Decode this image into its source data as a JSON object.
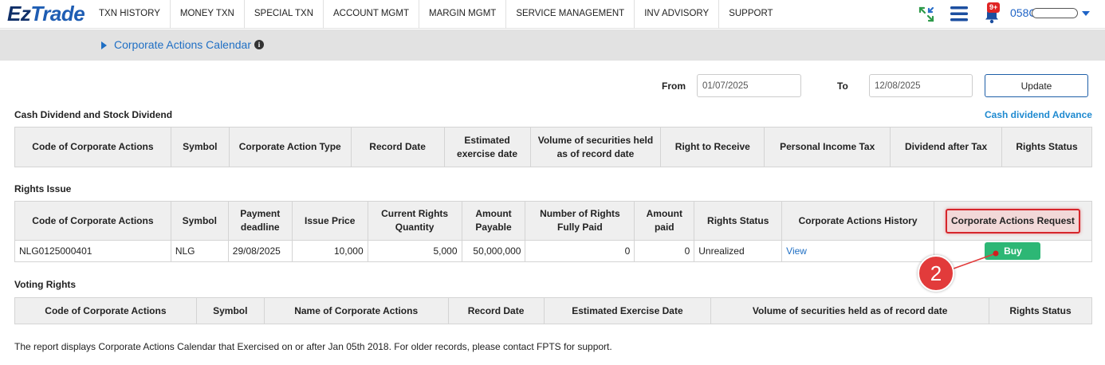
{
  "logo": {
    "part1": "Ez",
    "part2": "Trade"
  },
  "nav": [
    {
      "label": "TXN HISTORY"
    },
    {
      "label": "MONEY TXN"
    },
    {
      "label": "SPECIAL TXN"
    },
    {
      "label": "ACCOUNT MGMT"
    },
    {
      "label": "MARGIN MGMT"
    },
    {
      "label": "SERVICE MANAGEMENT"
    },
    {
      "label": "INV ADVISORY"
    },
    {
      "label": "SUPPORT"
    }
  ],
  "header_icons": {
    "expand": "expand-arrows-icon",
    "menu": "hamburger-menu-icon",
    "bell": "bell-icon",
    "badge": "9+"
  },
  "account": {
    "id_prefix": "058C"
  },
  "breadcrumb": {
    "title": "Corporate Actions Calendar"
  },
  "filter": {
    "from_label": "From",
    "from_value": "01/07/2025",
    "to_label": "To",
    "to_value": "12/08/2025",
    "update_label": "Update"
  },
  "cash": {
    "title": "Cash Dividend and Stock Dividend",
    "advance_link": "Cash dividend Advance",
    "headers": [
      "Code of Corporate Actions",
      "Symbol",
      "Corporate Action Type",
      "Record Date",
      "Estimated exercise date",
      "Volume of securities held as of record date",
      "Right to Receive",
      "Personal Income Tax",
      "Dividend after Tax",
      "Rights Status"
    ]
  },
  "rights": {
    "title": "Rights Issue",
    "headers": [
      "Code of Corporate Actions",
      "Symbol",
      "Payment deadline",
      "Issue Price",
      "Current Rights Quantity",
      "Amount Payable",
      "Number of Rights Fully Paid",
      "Amount paid",
      "Rights Status",
      "Corporate Actions History",
      "Corporate Actions Request"
    ],
    "row": {
      "code": "NLG0125000401",
      "symbol": "NLG",
      "deadline": "29/08/2025",
      "price": "10,000",
      "qty": "5,000",
      "payable": "50,000,000",
      "fully_paid": "0",
      "amount_paid": "0",
      "status": "Unrealized",
      "history": "View",
      "request": "Buy"
    }
  },
  "voting": {
    "title": "Voting Rights",
    "headers": [
      "Code of Corporate Actions",
      "Symbol",
      "Name of Corporate Actions",
      "Record Date",
      "Estimated Exercise Date",
      "Volume of securities held as of record date",
      "Rights Status"
    ]
  },
  "annotation": {
    "step": "2"
  },
  "footnote": "The report displays Corporate Actions Calendar that Exercised on or after Jan 05th 2018. For older records, please contact FPTS for support.",
  "colors": {
    "accent": "#1f6fc4",
    "buy": "#2db775",
    "highlight": "#d6252b"
  }
}
